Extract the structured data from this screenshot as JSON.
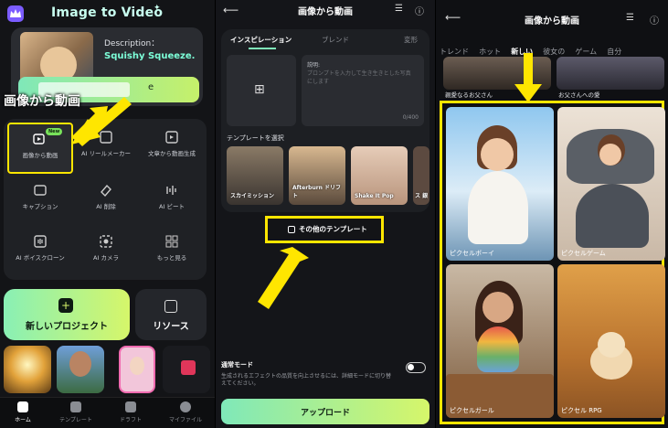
{
  "panel1": {
    "app_title": "Image to Video",
    "hero": {
      "description_label": "Description：",
      "description_value": "Squishy Squeeze.",
      "button_label": "e"
    },
    "overlay_label": "画像から動画",
    "tools": [
      {
        "label": "画像から動画",
        "icon": "image-to-video-icon",
        "badge": "New"
      },
      {
        "label": "AI リールメーカー",
        "icon": "reel-icon"
      },
      {
        "label": "文章から動画生成",
        "icon": "text-to-video-icon"
      },
      {
        "label": "キャプション",
        "icon": "caption-icon"
      },
      {
        "label": "AI 削除",
        "icon": "eraser-icon"
      },
      {
        "label": "AI ビート",
        "icon": "beat-icon"
      },
      {
        "label": "AI ボイスクローン",
        "icon": "voice-clone-icon"
      },
      {
        "label": "AI カメラ",
        "icon": "camera-icon"
      },
      {
        "label": "もっと見る",
        "icon": "grid-icon"
      }
    ],
    "new_project_label": "新しいプロジェクト",
    "resource_label": "リソース",
    "nav": [
      {
        "label": "ホーム",
        "active": true
      },
      {
        "label": "テンプレート",
        "active": false
      },
      {
        "label": "ドラフト",
        "active": false
      },
      {
        "label": "マイファイル",
        "active": false
      }
    ]
  },
  "panel2": {
    "title": "画像から動画",
    "tabs": [
      "インスピレーション",
      "ブレンド",
      "変形"
    ],
    "prompt_label": "説明:",
    "prompt_placeholder": "プロンプトを入力して生き生きとした写真にします",
    "char_count": "0/400",
    "template_label": "テンプレートを選択",
    "templates": [
      {
        "name": "スカイミッション"
      },
      {
        "name": "Afterburn ドリフト"
      },
      {
        "name": "Shake It Pop"
      },
      {
        "name": "ス 銀"
      }
    ],
    "more_templates_label": "その他のテンプレート",
    "mode_title": "通常モード",
    "mode_description": "生成されるエフェクトの品質を向上させるには、詳細モードに切り替えてください。",
    "upload_label": "アップロード"
  },
  "panel3": {
    "title": "画像から動画",
    "categories": [
      "トレンド",
      "ホット",
      "新しい",
      "彼女の",
      "ゲーム",
      "自分"
    ],
    "active_category": "新しい",
    "previous_row": [
      "親愛なるお父さん",
      "お父さんへの愛"
    ],
    "cards": [
      {
        "label": "ピクセルボーイ"
      },
      {
        "label": "ピクセルゲーム"
      },
      {
        "label": "ピクセルガール"
      },
      {
        "label": "ピクセル RPG"
      }
    ]
  },
  "colors": {
    "accent_green": "#7fe8b9",
    "accent_lime": "#d6f66a",
    "highlight_yellow": "#ffe600",
    "background": "#131417"
  }
}
